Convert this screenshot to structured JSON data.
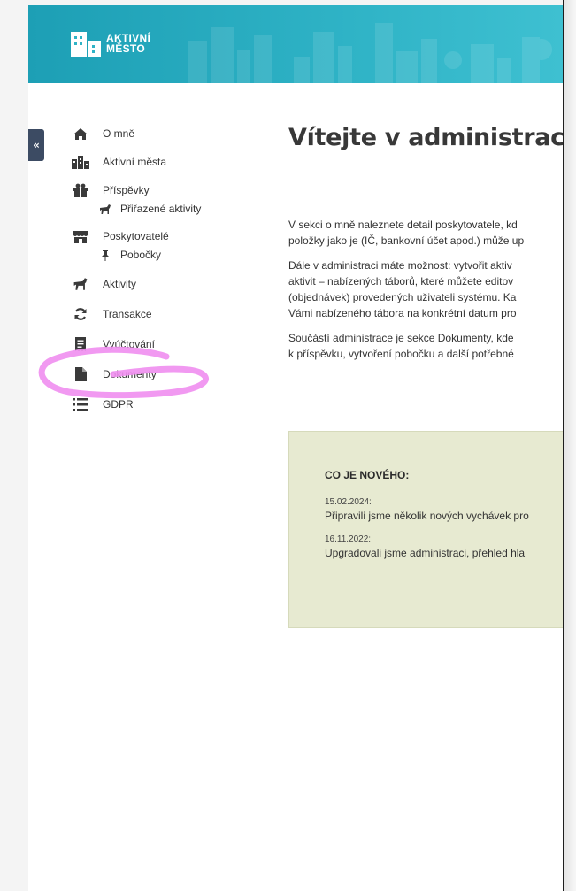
{
  "brand": {
    "line1": "AKTIVNÍ",
    "line2": "MĚSTO",
    "accent_color": "#2fb3c6"
  },
  "sidebar_toggle": {
    "icon": "double-chevron-left-icon",
    "glyph": "«"
  },
  "sidebar": {
    "items": [
      {
        "label": "O mně",
        "icon": "home-icon"
      },
      {
        "label": "Aktivní města",
        "icon": "city-icon"
      },
      {
        "label": "Příspěvky",
        "icon": "gift-icon"
      },
      {
        "label": "Přiřazené aktivity",
        "icon": "horse-icon",
        "sub": true
      },
      {
        "label": "Poskytovatelé",
        "icon": "store-icon"
      },
      {
        "label": "Pobočky",
        "icon": "pin-icon",
        "sub": true
      },
      {
        "label": "Aktivity",
        "icon": "horse-icon"
      },
      {
        "label": "Transakce",
        "icon": "sync-icon"
      },
      {
        "label": "Vyúčtování",
        "icon": "receipt-icon"
      },
      {
        "label": "Dokumenty",
        "icon": "file-icon"
      },
      {
        "label": "GDPR",
        "icon": "list-icon"
      }
    ]
  },
  "main": {
    "title": "Vítejte v administrac",
    "paragraphs": [
      [
        "V sekci o mně naleznete detail poskytovatele, kd",
        "položky jako je (IČ, bankovní účet apod.) může up"
      ],
      [
        "Dále v administraci máte možnost: vytvořit aktiv",
        "aktivit – nabízených táborů, které můžete editov",
        "(objednávek) provedených uživateli systému. Ka",
        "Vámi nabízeného tábora na konkrétní datum pro"
      ],
      [
        "Součástí administrace je sekce Dokumenty, kde",
        "k příspěvku, vytvoření pobočku a další potřebné"
      ]
    ]
  },
  "news": {
    "title": "CO JE NOVÉHO:",
    "entries": [
      {
        "date": "15.02.2024:",
        "text": "Připravili jsme několik nových vychávek pro"
      },
      {
        "date": "16.11.2022:",
        "text": "Upgradovali jsme administraci, přehled hla"
      }
    ]
  },
  "annotation": {
    "color": "#f08ef0"
  }
}
